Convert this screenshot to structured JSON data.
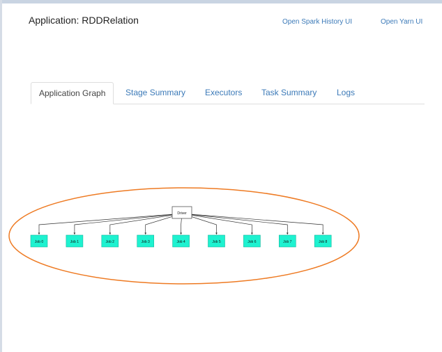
{
  "header": {
    "app_title": "Application: RDDRelation",
    "link_spark_history": "Open Spark History UI",
    "link_yarn": "Open Yarn UI"
  },
  "tabs": [
    {
      "label": "Application Graph",
      "active": true
    },
    {
      "label": "Stage Summary",
      "active": false
    },
    {
      "label": "Executors",
      "active": false
    },
    {
      "label": "Task Summary",
      "active": false
    },
    {
      "label": "Logs",
      "active": false
    }
  ],
  "graph": {
    "root": "Driver",
    "jobs": [
      "Job 0",
      "Job 1",
      "Job 2",
      "Job 3",
      "Job 4",
      "Job 5",
      "Job 6",
      "Job 7",
      "Job 8"
    ],
    "colors": {
      "job_fill": "#1ef2d0",
      "job_stroke": "#16b79d",
      "driver_fill": "#ffffff",
      "driver_stroke": "#555555",
      "edge": "#333333",
      "annotation_ellipse": "#ee7a22"
    }
  }
}
